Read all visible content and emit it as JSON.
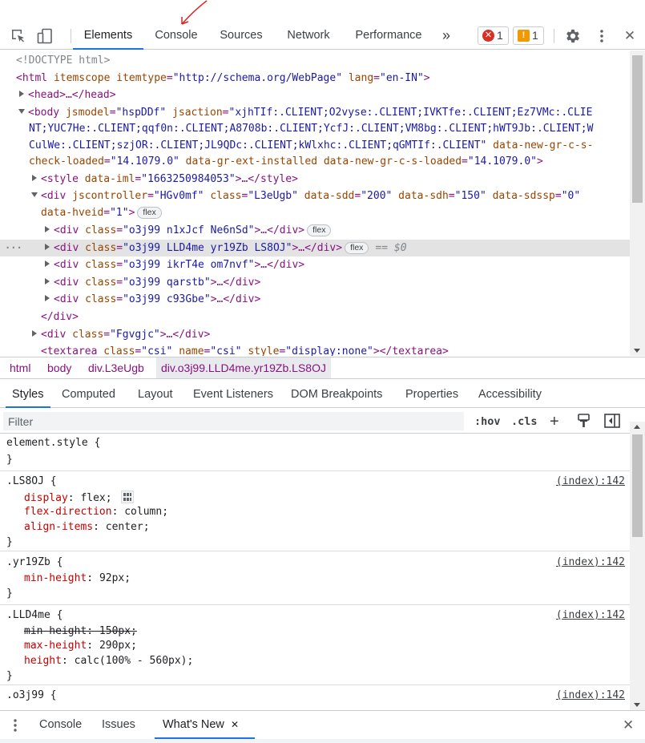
{
  "toolbar": {
    "tabs": [
      {
        "label": "Elements",
        "active": true
      },
      {
        "label": "Console"
      },
      {
        "label": "Sources"
      },
      {
        "label": "Network"
      },
      {
        "label": "Performance"
      }
    ],
    "more_tabs_glyph": "»",
    "error_count": "1",
    "warning_count": "1",
    "close_glyph": "✕"
  },
  "dom_lines": {
    "doctype": "<!DOCTYPE html>",
    "html_open": "<html",
    "html_itemscope": " itemscope",
    "html_itemtype_attr": " itemtype",
    "html_itemtype_val": "\"http://schema.org/WebPage\"",
    "html_lang_attr": " lang",
    "html_lang_val": "\"en-IN\"",
    "head": "<head>…</head>",
    "body_open": "<body",
    "body_jsmodel_attr": " jsmodel",
    "body_jsmodel_val": "\"hspDDf\"",
    "body_jsaction_attr": " jsaction",
    "body_jsaction_1": "\"xjhTIf:.CLIENT;O2vyse:.CLIENT;IVKTfe:.CLIENT;Ez7VMc:.CLIE",
    "body_jsaction_2": "NT;YUC7He:.CLIENT;qqf0n:.CLIENT;A8708b:.CLIENT;YcfJ:.CLIENT;VM8bg:.CLIENT;hWT9Jb:.CLIENT;W",
    "body_jsaction_3": "CulWe:.CLIENT;szjOR:.CLIENT;JL9QDc:.CLIENT;kWlxhc:.CLIENT;qGMTIf:.CLIENT\"",
    "body_attr_ngrcs": " data-new-gr-c-s-",
    "body_attr_check": "check-loaded",
    "body_check_val": "\"14.1079.0\"",
    "body_ext_attr": " data-gr-ext-installed",
    "body_loaded_attr": " data-new-gr-c-s-loaded",
    "body_loaded_val": "\"14.1079.0\"",
    "style_tag": "<style",
    "style_attr": " data-iml",
    "style_val": "\"1663250984053\"",
    "style_rest": ">…</style>",
    "div_open": "<div",
    "div_jsc_attr": " jscontroller",
    "div_jsc_val": "\"HGv0mf\"",
    "div_class_attr": " class",
    "div_class_val": "\"L3eUgb\"",
    "div_sdd_attr": " data-sdd",
    "div_sdd_val": "\"200\"",
    "div_sdh_attr": " data-sdh",
    "div_sdh_val": "\"150\"",
    "div_sdssp_attr": " data-sdssp",
    "div_sdssp_val": "\"0\"",
    "div_hveid_attr": "data-hveid",
    "div_hveid_val": "\"1\"",
    "flex_pill": "flex",
    "child1_cls": "\"o3j99 n1xJcf Ne6nSd\"",
    "child2_cls": "\"o3j99 LLD4me yr19Zb LS8OJ\"",
    "child3_cls": "\"o3j99 ikrT4e om7nvf\"",
    "child4_cls": "\"o3j99 qarstb\"",
    "child5_cls": "\"o3j99 c93Gbe\"",
    "div_close": "</div>",
    "fgv_cls": "\"Fgvgjc\"",
    "eq_dollar": "== $0",
    "ellipsis_tail": ">…</div>",
    "textarea_open": "<textarea",
    "ta_class_val": "\"csi\"",
    "ta_name_attr": " name",
    "ta_name_val": "\"csi\"",
    "ta_style_attr": " style",
    "ta_style_val": "\"display:none\"",
    "ta_close": "></textarea>",
    "class_word": " class",
    "eq": "=",
    "gt": ">",
    "row_dots": "…"
  },
  "breadcrumbs": [
    "html",
    "body",
    "div.L3eUgb",
    "div.o3j99.LLD4me.yr19Zb.LS8OJ"
  ],
  "subtabs": [
    "Styles",
    "Computed",
    "Layout",
    "Event Listeners",
    "DOM Breakpoints",
    "Properties",
    "Accessibility"
  ],
  "filter": {
    "placeholder": "Filter",
    "hov": ":hov",
    "cls": ".cls",
    "plus": "+"
  },
  "styles": {
    "element_style": "element.style {",
    "close_brace": "}",
    "source": "(index):142",
    "r1_sel": ".LS8OJ {",
    "r1_p1": "display",
    "r1_v1": "flex;",
    "r1_p2": "flex-direction",
    "r1_v2": "column;",
    "r1_p3": "align-items",
    "r1_v3": "center;",
    "r2_sel": ".yr19Zb {",
    "r2_p1": "min-height",
    "r2_v1": "92px;",
    "r3_sel": ".LLD4me {",
    "r3_p1": "min-height: 150px;",
    "r3_p2": "max-height",
    "r3_v2": "290px;",
    "r3_p3": "height",
    "r3_v3": "calc(100% - 560px);",
    "r4_sel": ".o3j99 {",
    "colon": ":"
  },
  "drawer": {
    "tabs": [
      "Console",
      "Issues",
      "What's New"
    ],
    "close_glyph": "✕"
  },
  "colors": {
    "accent": "#1a73e8",
    "error": "#d93025",
    "warning": "#f29900"
  }
}
